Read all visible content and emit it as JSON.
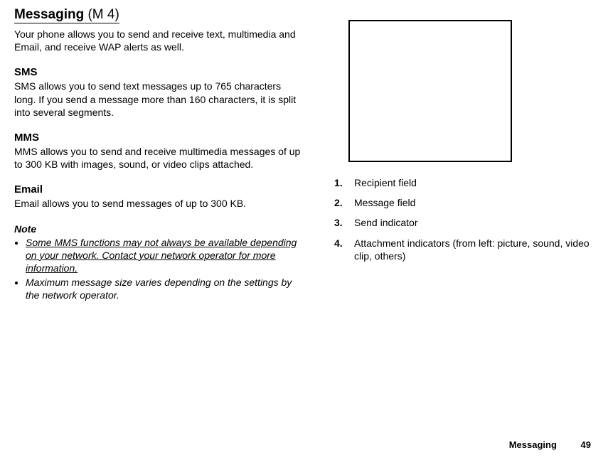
{
  "header": {
    "title_main": "Messaging",
    "title_suffix": " (M 4)"
  },
  "intro": "Your phone allows you to send and receive text, multimedia and Email, and receive WAP alerts as well.",
  "sections": {
    "sms": {
      "heading": "SMS",
      "body": "SMS allows you to send text messages up to 765 characters long. If you send a message more than 160 characters, it is split into several segments."
    },
    "mms": {
      "heading": "MMS",
      "body": "MMS allows you to send and receive multimedia messages of up to 300 KB with images, sound, or video clips attached."
    },
    "email": {
      "heading": "Email",
      "body": "Email allows you to send messages of up to 300 KB."
    }
  },
  "note": {
    "heading": "Note",
    "item1": "Some MMS functions may not always be available depending on your network. Contact your network operator for more information.",
    "item2": "Maximum message size varies depending on the settings by the network operator."
  },
  "legend": {
    "n1": "1.",
    "t1": "Recipient field",
    "n2": "2.",
    "t2": "Message field",
    "n3": "3.",
    "t3": "Send indicator",
    "n4": "4.",
    "t4": "Attachment indicators (from left: picture, sound, video clip, others)"
  },
  "footer": {
    "section": "Messaging",
    "page": "49"
  }
}
